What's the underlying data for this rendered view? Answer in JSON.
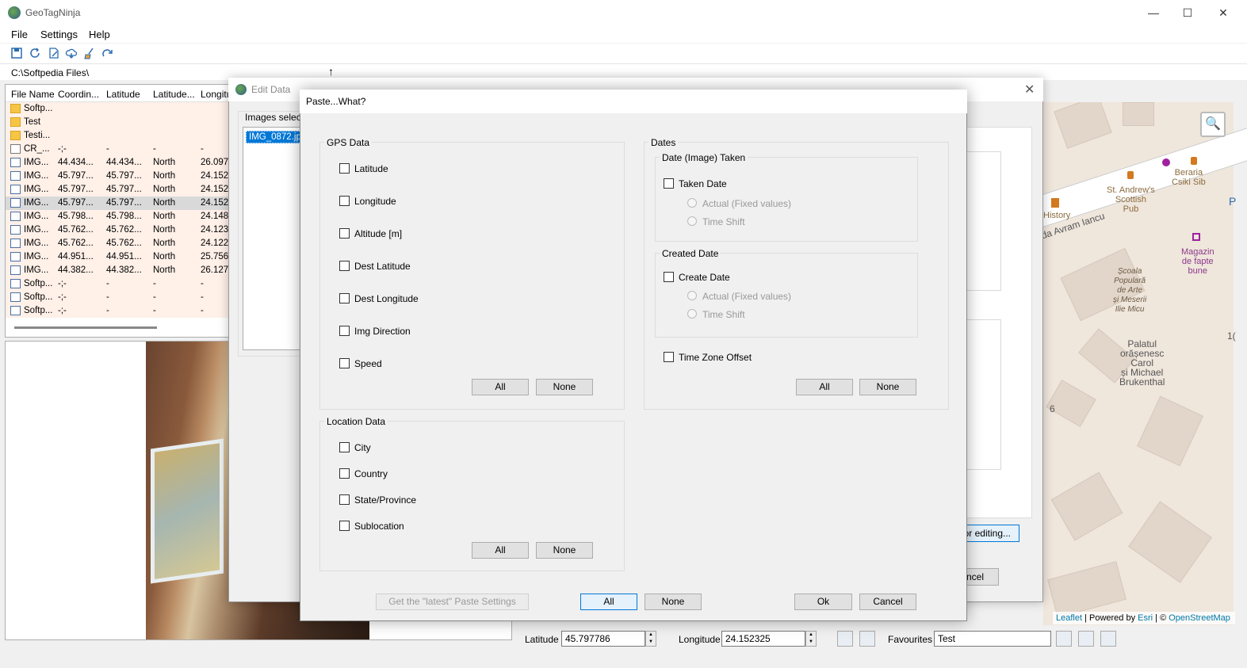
{
  "app": {
    "title": "GeoTagNinja"
  },
  "window_controls": {
    "minimize": "—",
    "maximize": "☐",
    "close": "✕"
  },
  "menu": [
    "File",
    "Settings",
    "Help"
  ],
  "path": "C:\\Softpedia Files\\",
  "up_arrow": "↑",
  "filelist": {
    "headers": [
      "File Name",
      "Coordin...",
      "Latitude",
      "Latitude...",
      "Longitu"
    ],
    "rows": [
      {
        "icon": "folder",
        "name": "Softp...",
        "coord": "",
        "lat": "",
        "latref": "",
        "lon": ""
      },
      {
        "icon": "folder",
        "name": "Test",
        "coord": "",
        "lat": "",
        "latref": "",
        "lon": ""
      },
      {
        "icon": "folder",
        "name": "Testi...",
        "coord": "",
        "lat": "",
        "latref": "",
        "lon": ""
      },
      {
        "icon": "file",
        "name": "CR_...",
        "coord": "-;-",
        "lat": "-",
        "latref": "-",
        "lon": "-"
      },
      {
        "icon": "image",
        "name": "IMG...",
        "coord": "44.434...",
        "lat": "44.434...",
        "latref": "North",
        "lon": "26.097"
      },
      {
        "icon": "image",
        "name": "IMG...",
        "coord": "45.797...",
        "lat": "45.797...",
        "latref": "North",
        "lon": "24.152"
      },
      {
        "icon": "image",
        "name": "IMG...",
        "coord": "45.797...",
        "lat": "45.797...",
        "latref": "North",
        "lon": "24.152"
      },
      {
        "icon": "image",
        "name": "IMG...",
        "coord": "45.797...",
        "lat": "45.797...",
        "latref": "North",
        "lon": "24.152",
        "selected": true
      },
      {
        "icon": "image",
        "name": "IMG...",
        "coord": "45.798...",
        "lat": "45.798...",
        "latref": "North",
        "lon": "24.148"
      },
      {
        "icon": "image",
        "name": "IMG...",
        "coord": "45.762...",
        "lat": "45.762...",
        "latref": "North",
        "lon": "24.123"
      },
      {
        "icon": "image",
        "name": "IMG...",
        "coord": "45.762...",
        "lat": "45.762...",
        "latref": "North",
        "lon": "24.122"
      },
      {
        "icon": "image",
        "name": "IMG...",
        "coord": "44.951...",
        "lat": "44.951...",
        "latref": "North",
        "lon": "25.756"
      },
      {
        "icon": "image",
        "name": "IMG...",
        "coord": "44.382...",
        "lat": "44.382...",
        "latref": "North",
        "lon": "26.127"
      },
      {
        "icon": "image",
        "name": "Softp...",
        "coord": "-;-",
        "lat": "-",
        "latref": "-",
        "lon": "-"
      },
      {
        "icon": "image",
        "name": "Softp...",
        "coord": "-;-",
        "lat": "-",
        "latref": "-",
        "lon": "-"
      },
      {
        "icon": "image",
        "name": "Softp...",
        "coord": "-;-",
        "lat": "-",
        "latref": "-",
        "lon": "-"
      }
    ]
  },
  "map": {
    "labels": {
      "berarla": "Beraria\nCsiki Sib",
      "standrews": "St. Andrew's\nScottish\nPub",
      "history": "History",
      "street": "da Avram Iancu",
      "magazin": "Magazin\nde fapte\nbune",
      "scoala": "Școala\nPopulară\nde Arte\nși Meserii\nIlie Micu",
      "palatul": "Palatul\norășenesc\nCarol\nși Michael\nBrukenthal",
      "num6": "6",
      "p": "P",
      "n1": "1("
    },
    "search_icon": "🔍",
    "attribution": {
      "leaflet": "Leaflet",
      "powered": " | Powered by ",
      "esri": "Esri",
      "sep": " | © ",
      "osm": "OpenStreetMap"
    }
  },
  "bottombar": {
    "latitude_label": "Latitude",
    "latitude_value": "45.797786",
    "longitude_label": "Longitude",
    "longitude_value": "24.152325",
    "favourites_label": "Favourites",
    "favourites_value": "Test"
  },
  "edit_data": {
    "title": "Edit Data",
    "images_selected_label": "Images selecte",
    "selected_image": "IMG_0872.jpg",
    "editing_button": "or editing...",
    "cancel_button": "ncel",
    "close": "✕"
  },
  "paste_dialog": {
    "title": "Paste...What?",
    "gps": {
      "title": "GPS Data",
      "items": [
        "Latitude",
        "Longitude",
        "Altitude [m]",
        "Dest Latitude",
        "Dest Longitude",
        "Img Direction",
        "Speed"
      ],
      "all": "All",
      "none": "None"
    },
    "location": {
      "title": "Location Data",
      "items": [
        "City",
        "Country",
        "State/Province",
        "Sublocation"
      ],
      "all": "All",
      "none": "None"
    },
    "dates": {
      "title": "Dates",
      "taken_group": "Date (Image) Taken",
      "taken_date": "Taken Date",
      "created_group": "Created Date",
      "create_date": "Create Date",
      "actual": "Actual (Fixed values)",
      "time_shift": "Time Shift",
      "time_zone": "Time Zone Offset",
      "all": "All",
      "none": "None"
    },
    "footer": {
      "latest": "Get the \"latest\" Paste Settings",
      "all": "All",
      "none": "None",
      "ok": "Ok",
      "cancel": "Cancel"
    }
  }
}
